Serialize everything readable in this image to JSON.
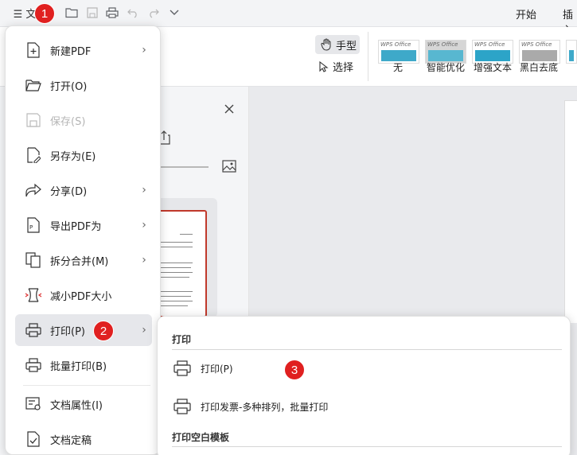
{
  "topbar": {
    "file_label": "☰ 文",
    "right_tabs": [
      "开始",
      "插入"
    ]
  },
  "ribbon": {
    "hand_label": "手型",
    "select_label": "选择",
    "thumb_wps_text": "WPS Office",
    "thumbs": [
      {
        "label": "无",
        "color": "#3ea9c9"
      },
      {
        "label": "智能优化",
        "color": "#58b7d0"
      },
      {
        "label": "增强文本",
        "color": "#2ca4c8"
      },
      {
        "label": "黑白去底",
        "color": "#aaaaaa"
      }
    ]
  },
  "menu": {
    "items": [
      {
        "label": "新建PDF",
        "submenu": true,
        "icon": "new-pdf-icon"
      },
      {
        "label": "打开(O)",
        "submenu": false,
        "icon": "folder-open-icon"
      },
      {
        "label": "保存(S)",
        "submenu": false,
        "icon": "save-icon",
        "disabled": true
      },
      {
        "label": "另存为(E)",
        "submenu": false,
        "icon": "save-as-icon"
      },
      {
        "label": "分享(D)",
        "submenu": true,
        "icon": "share-icon"
      },
      {
        "label": "导出PDF为",
        "submenu": true,
        "icon": "export-pdf-icon"
      },
      {
        "label": "拆分合并(M)",
        "submenu": true,
        "icon": "split-merge-icon"
      },
      {
        "label": "减小PDF大小",
        "submenu": false,
        "icon": "compress-icon"
      },
      {
        "label": "打印(P)",
        "submenu": true,
        "icon": "printer-icon",
        "active": true
      },
      {
        "label": "批量打印(B)",
        "submenu": false,
        "icon": "batch-print-icon"
      },
      {
        "label": "文档属性(I)",
        "submenu": false,
        "icon": "doc-properties-icon"
      },
      {
        "label": "文档定稿",
        "submenu": false,
        "icon": "finalize-icon"
      }
    ]
  },
  "submenu": {
    "heading": "打印",
    "items": [
      {
        "label": "打印(P)"
      },
      {
        "label": "打印发票-多种排列，批量打印"
      }
    ],
    "section2": "打印空白模板"
  },
  "badges": [
    "1",
    "2",
    "3"
  ],
  "colors": {
    "badge": "#e02020",
    "accent_border": "#c0392b"
  }
}
